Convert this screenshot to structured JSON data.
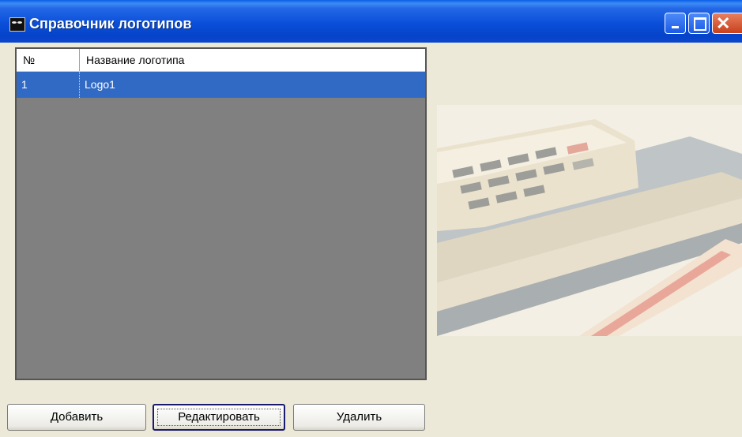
{
  "window": {
    "title": "Справочник логотипов"
  },
  "title_buttons": {
    "min_icon": "minimize-icon",
    "max_icon": "maximize-icon",
    "close_icon": "close-icon"
  },
  "table": {
    "columns": [
      "№",
      "Название логотипа"
    ],
    "rows": [
      {
        "num": "1",
        "name": "Logo1",
        "selected": true
      }
    ]
  },
  "buttons": {
    "add": "Добавить",
    "edit": "Редактировать",
    "delete": "Удалить"
  },
  "colors": {
    "titlebar": "#0a4fd9",
    "selection": "#316ac5",
    "list_bg": "#808080",
    "dialog_bg": "#ece9d8"
  }
}
